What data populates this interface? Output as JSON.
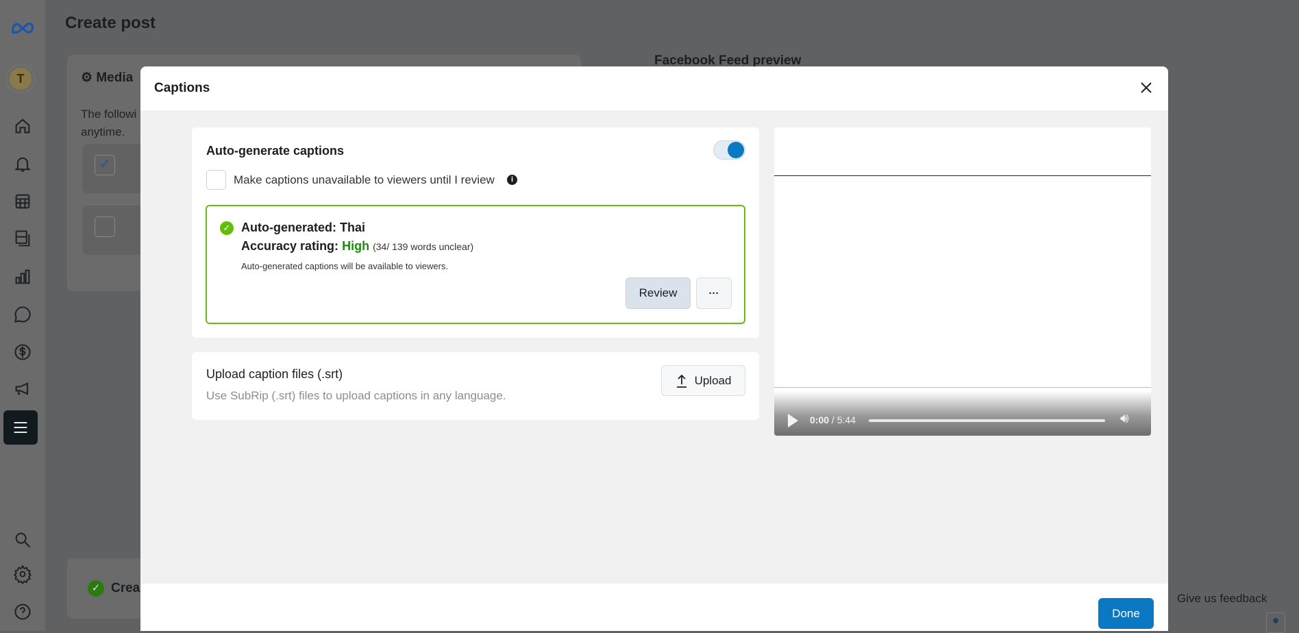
{
  "background": {
    "page_title": "Create post",
    "media_card_title": "Media",
    "media_card_text_1": "The followi",
    "media_card_text_2": "anytime.",
    "preview_title": "Facebook Feed preview",
    "bottom_card_text": "Crea",
    "feedback_link": "Give us feedback",
    "avatar_initial": "T"
  },
  "sidebar": {
    "icons": [
      "meta-logo",
      "home-icon",
      "bell-icon",
      "table-icon",
      "pages-icon",
      "chart-icon",
      "chat-icon",
      "dollar-icon",
      "megaphone-icon",
      "menu-icon",
      "search-icon",
      "gear-icon",
      "help-icon"
    ]
  },
  "modal": {
    "title": "Captions",
    "auto": {
      "title": "Auto-generate captions",
      "toggle_on": true,
      "checkbox_label": "Make captions unavailable to viewers until I review",
      "checkbox_checked": false,
      "result_title": "Auto-generated: Thai",
      "accuracy_label": "Accuracy rating:",
      "accuracy_value": "High",
      "accuracy_detail": "(34/ 139 words unclear)",
      "note": "Auto-generated captions will be available to viewers.",
      "review_label": "Review",
      "more_label": "···"
    },
    "upload": {
      "title": "Upload caption files (.srt)",
      "subtitle": "Use SubRip (.srt) files to upload captions in any language.",
      "button_label": "Upload"
    },
    "video": {
      "current_time": "0:00",
      "duration": "/ 5:44",
      "progress": 0
    },
    "done_label": "Done"
  },
  "colors": {
    "accent": "#0a78c2",
    "success": "#63be09",
    "high": "#1e8a0e"
  }
}
